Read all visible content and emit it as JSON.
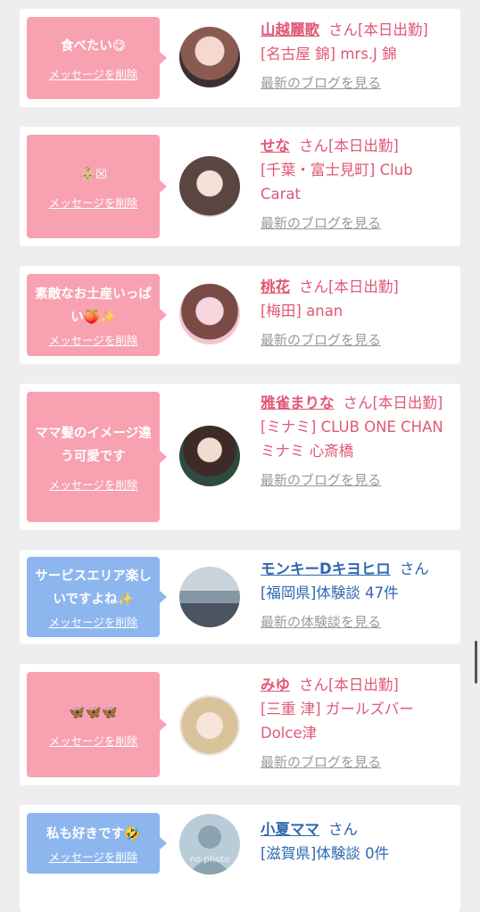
{
  "cards": [
    {
      "message": "食べたい😋",
      "delete": "メッセージを削除",
      "name": "山越麗歌",
      "san": "さん",
      "status": "[本日出勤]",
      "shop": "[名古屋 錦] mrs.J 錦",
      "link": "最新のブログを見る"
    },
    {
      "message": "👶🏼☒",
      "delete": "メッセージを削除",
      "name": "せな",
      "san": "さん",
      "status": "[本日出勤]",
      "shop": "[千葉・富士見町] Club Carat",
      "link": "最新のブログを見る"
    },
    {
      "message": "素敵なお土産いっぱい🍑✨",
      "delete": "メッセージを削除",
      "name": "桃花",
      "san": "さん",
      "status": "[本日出勤]",
      "shop": "[梅田] anan",
      "link": "最新のブログを見る"
    },
    {
      "message": "ママ髪のイメージ違う可愛です",
      "delete": "メッセージを削除",
      "name": "雅雀まりな",
      "san": "さん",
      "status": "[本日出勤]",
      "shop": "[ミナミ] CLUB ONE CHAN ミナミ 心斎橋",
      "link": "最新のブログを見る"
    },
    {
      "message": "サービスエリア楽しいですよね✨",
      "delete": "メッセージを削除",
      "name": "モンキーDキヨヒロ",
      "san": "さん",
      "status": "",
      "shop": "[福岡県]体験談 47件",
      "link": "最新の体験談を見る"
    },
    {
      "message": "🦋🦋🦋",
      "delete": "メッセージを削除",
      "name": "みゆ",
      "san": "さん",
      "status": "[本日出勤]",
      "shop": "[三重 津] ガールズバー Dolce津",
      "link": "最新のブログを見る"
    },
    {
      "message": "私も好きです🤣",
      "delete": "メッセージを削除",
      "name": "小夏ママ",
      "san": "さん",
      "status": "",
      "shop": "[滋賀県]体験談 0件",
      "link": "",
      "avatar_text": "no photo"
    }
  ],
  "colors": {
    "pink": "#f7a1b1",
    "blue": "#8db6ee",
    "cast_text": "#e05876",
    "user_text": "#2f67b0"
  }
}
